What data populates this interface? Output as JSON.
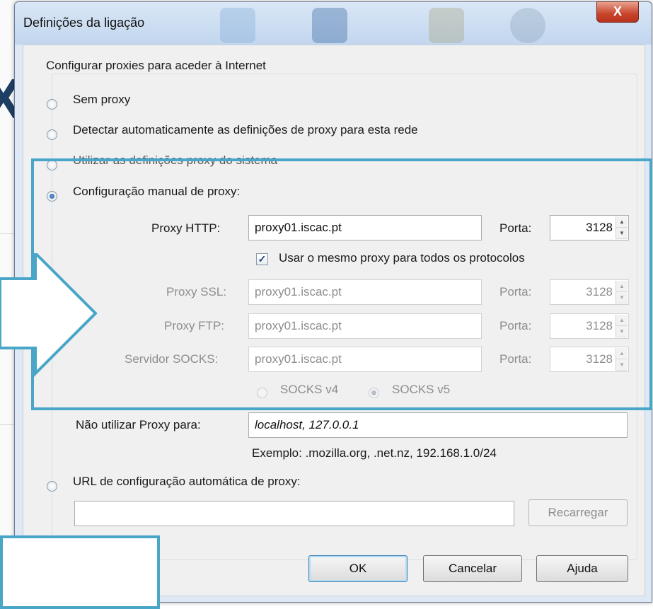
{
  "dialog": {
    "title": "Definições da ligação",
    "close_glyph": "X"
  },
  "background": {
    "partial_text": "X"
  },
  "proxy_group": {
    "title": "Configurar proxies para aceder à Internet",
    "options": {
      "no_proxy": {
        "label": "Sem proxy",
        "selected": false
      },
      "auto_detect": {
        "label": "Detectar automaticamente as definições de proxy para esta rede",
        "selected": false
      },
      "system": {
        "label": "Utilizar as definições proxy do sistema",
        "selected": false
      },
      "manual": {
        "label": "Configuração manual de proxy:",
        "selected": true
      },
      "auto_url": {
        "label": "URL de configuração automática de proxy:",
        "selected": false
      }
    },
    "http": {
      "label": "Proxy HTTP:",
      "value": "proxy01.iscac.pt",
      "port_label": "Porta:",
      "port": "3128"
    },
    "same_proxy": {
      "label": "Usar o mesmo proxy para todos os protocolos",
      "checked": true,
      "glyph": "✓"
    },
    "ssl": {
      "label": "Proxy SSL:",
      "value": "proxy01.iscac.pt",
      "port_label": "Porta:",
      "port": "3128"
    },
    "ftp": {
      "label": "Proxy FTP:",
      "value": "proxy01.iscac.pt",
      "port_label": "Porta:",
      "port": "3128"
    },
    "socks": {
      "label": "Servidor SOCKS:",
      "value": "proxy01.iscac.pt",
      "port_label": "Porta:",
      "port": "3128"
    },
    "socks_version": {
      "v4_label": "SOCKS v4",
      "v5_label": "SOCKS v5",
      "selected": "v5"
    },
    "no_proxy_for": {
      "label": "Não utilizar Proxy para:",
      "value": "localhost, 127.0.0.1"
    },
    "example": "Exemplo: .mozilla.org, .net.nz, 192.168.1.0/24",
    "auto_url_value": "",
    "reload_label": "Recarregar"
  },
  "buttons": {
    "ok": "OK",
    "cancel": "Cancelar",
    "help": "Ajuda"
  },
  "colors": {
    "highlight": "#4aa6c8",
    "titlebar": "#c2d6ee",
    "close": "#c7442b"
  }
}
